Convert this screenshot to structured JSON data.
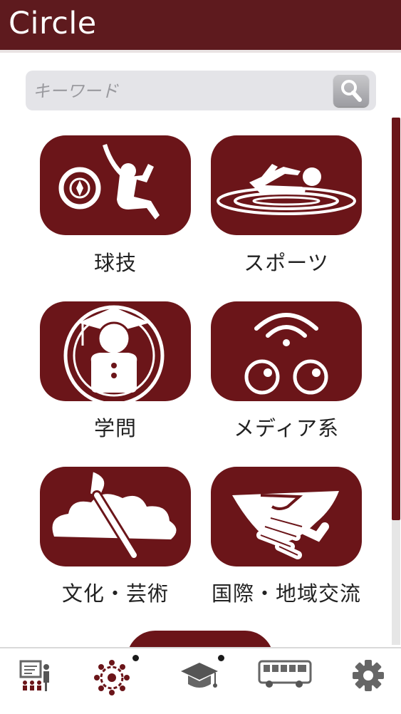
{
  "app": {
    "title": "Circle"
  },
  "search": {
    "placeholder": "キーワード"
  },
  "categories": [
    {
      "label": "球技",
      "icon": "ball-sports-icon"
    },
    {
      "label": "スポーツ",
      "icon": "swimming-icon"
    },
    {
      "label": "学問",
      "icon": "academic-icon"
    },
    {
      "label": "メディア系",
      "icon": "media-icon"
    },
    {
      "label": "文化・芸術",
      "icon": "art-brush-icon"
    },
    {
      "label": "国際・地域交流",
      "icon": "handshake-icon"
    }
  ],
  "tabs": [
    {
      "icon": "presentation-icon"
    },
    {
      "icon": "circle-people-icon"
    },
    {
      "icon": "graduation-cap-icon"
    },
    {
      "icon": "bus-icon"
    },
    {
      "icon": "gear-icon"
    }
  ],
  "colors": {
    "primary": "#6b1519",
    "header": "#5e1a1e",
    "search_bg": "#e4e4e8"
  }
}
